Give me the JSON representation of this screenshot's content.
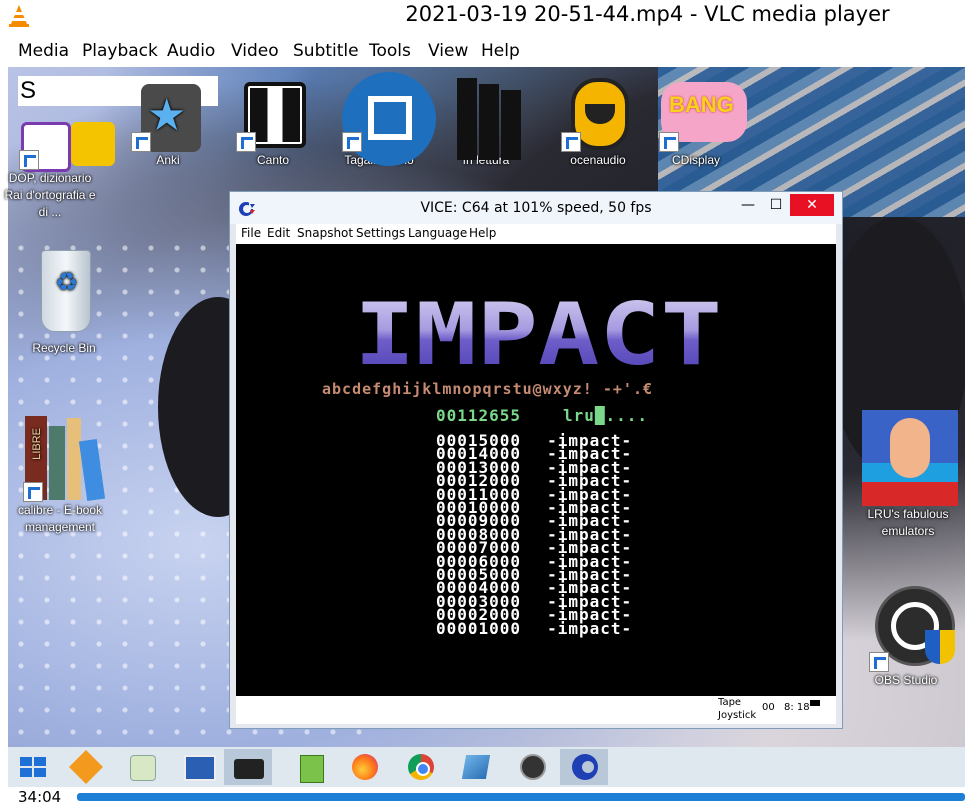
{
  "vlc": {
    "title": "2021-03-19 20-51-44.mp4 - VLC media player",
    "menu": [
      "Media",
      "Playback",
      "Audio",
      "Video",
      "Subtitle",
      "Tools",
      "View",
      "Help"
    ],
    "time": "34:04",
    "progress_fraction": 1.0
  },
  "desktop": {
    "search_text": "S",
    "icons": [
      {
        "label": "DOP, dizionario Rai d'ortografia e di ...",
        "icon": "dop-icon"
      },
      {
        "label": "Anki",
        "icon": "anki-icon"
      },
      {
        "label": "Canto",
        "icon": "canto-icon"
      },
      {
        "label": "Tagaini Jisho",
        "icon": "tagaini-icon"
      },
      {
        "label": "In lettura",
        "icon": "books-icon"
      },
      {
        "label": "ocenaudio",
        "icon": "ocenaudio-icon"
      },
      {
        "label": "CDisplay",
        "icon": "cdisplay-icon"
      },
      {
        "label": "Recycle Bin",
        "icon": "recycle-bin-icon"
      },
      {
        "label": "calibre - E-book management",
        "icon": "calibre-icon"
      },
      {
        "label": "LRU's fabulous emulators",
        "icon": "lru-icon"
      },
      {
        "label": "OBS Studio",
        "icon": "obs-icon"
      }
    ],
    "bang_text": "BANG",
    "calibre_text": "LIBRE"
  },
  "vice": {
    "title": "VICE: C64 at 101% speed, 50 fps",
    "menu": [
      "File",
      "Edit",
      "Snapshot",
      "Settings",
      "Language",
      "Help"
    ],
    "buttons": {
      "minimize": "—",
      "maximize": "☐",
      "close": "✕"
    },
    "status": {
      "tape": "Tape",
      "joystick": "Joystick",
      "counter": "00",
      "drive": "8: 18"
    },
    "screen": {
      "logo": "IMPACT",
      "charset": "abcdefghijklmnopqrstu@wxyz! -+'.€",
      "hiscore": "00112655",
      "hiscore_name": "lru█....",
      "scores": [
        {
          "score": "00015000",
          "name": "-impact-"
        },
        {
          "score": "00014000",
          "name": "-impact-"
        },
        {
          "score": "00013000",
          "name": "-impact-"
        },
        {
          "score": "00012000",
          "name": "-impact-"
        },
        {
          "score": "00011000",
          "name": "-impact-"
        },
        {
          "score": "00010000",
          "name": "-impact-"
        },
        {
          "score": "00009000",
          "name": "-impact-"
        },
        {
          "score": "00008000",
          "name": "-impact-"
        },
        {
          "score": "00007000",
          "name": "-impact-"
        },
        {
          "score": "00006000",
          "name": "-impact-"
        },
        {
          "score": "00005000",
          "name": "-impact-"
        },
        {
          "score": "00004000",
          "name": "-impact-"
        },
        {
          "score": "00003000",
          "name": "-impact-"
        },
        {
          "score": "00002000",
          "name": "-impact-"
        },
        {
          "score": "00001000",
          "name": "-impact-"
        }
      ]
    }
  },
  "taskbar": {
    "items": [
      "windows-start-icon",
      "fl-studio-icon",
      "paint-icon",
      "screenshot-tool-icon",
      "toolbox-icon",
      "notepad-icon",
      "firefox-icon",
      "chrome-icon",
      "editor-icon",
      "obs-icon",
      "vice-c64-icon"
    ]
  }
}
